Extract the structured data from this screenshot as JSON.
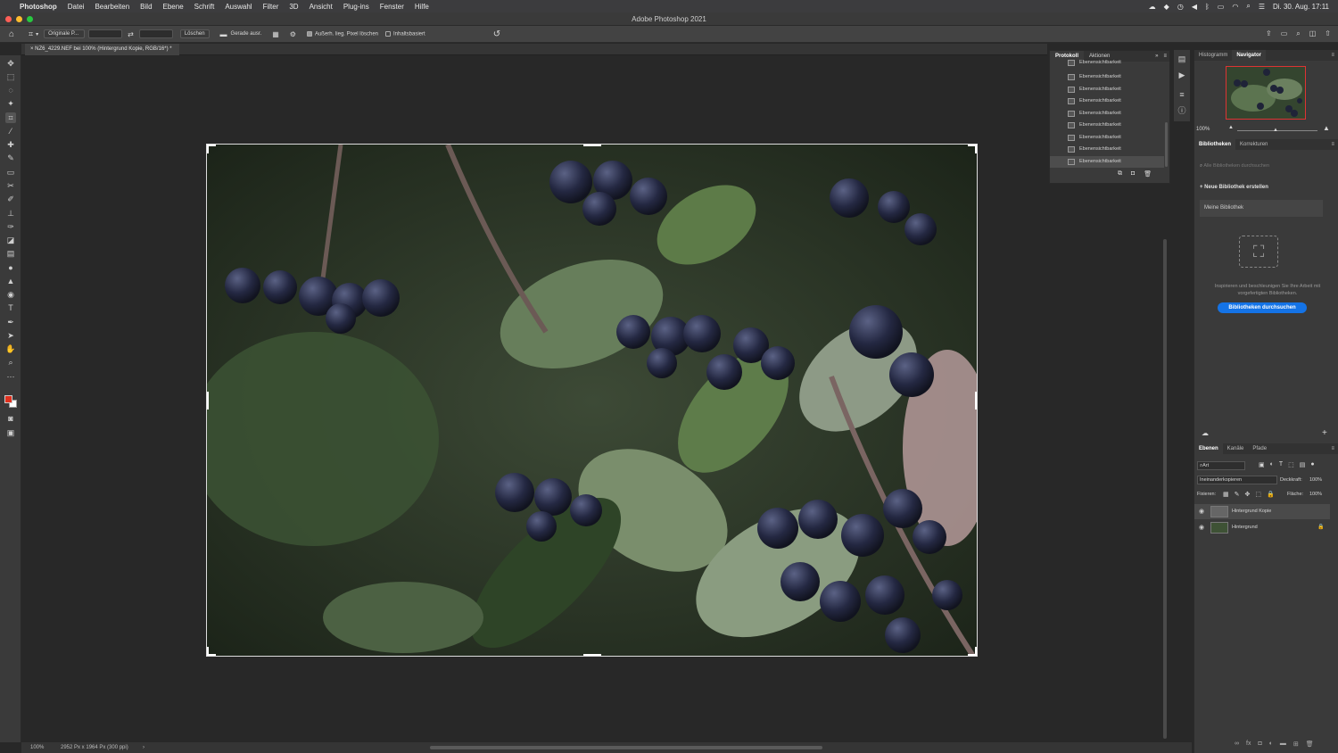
{
  "menubar": {
    "app_name": "Photoshop",
    "items": [
      "Datei",
      "Bearbeiten",
      "Bild",
      "Ebene",
      "Schrift",
      "Auswahl",
      "Filter",
      "3D",
      "Ansicht",
      "Plug-ins",
      "Fenster",
      "Hilfe"
    ],
    "datetime": "Di. 30. Aug.  17:11"
  },
  "window": {
    "title": "Adobe Photoshop 2021"
  },
  "options": {
    "ratio_select": "Originale P...",
    "clear_label": "Löschen",
    "straighten_label": "Gerade ausr.",
    "delete_cropped_label": "Außerh. lieg. Pixel löschen",
    "content_aware_label": "Inhaltsbasiert"
  },
  "document": {
    "tab_title": "NZ6_4229.NEF bei 100% (Hintergrund Kopie, RGB/16*) *",
    "zoom": "100%",
    "info": "2952 Px x 1964 Px (300 ppi)"
  },
  "protocol": {
    "tabs": [
      "Protokoll",
      "Aktionen"
    ],
    "items": [
      "Ebenensichtbarkeit",
      "Ebenensichtbarkeit",
      "Ebenensichtbarkeit",
      "Ebenensichtbarkeit",
      "Ebenensichtbarkeit",
      "Ebenensichtbarkeit",
      "Ebenensichtbarkeit",
      "Ebenensichtbarkeit",
      "Ebenensichtbarkeit"
    ]
  },
  "navigator": {
    "tabs": [
      "Histogramm",
      "Navigator"
    ],
    "zoom": "100%"
  },
  "libraries": {
    "tabs": [
      "Bibliotheken",
      "Korrekturen"
    ],
    "search_placeholder": "Alle Bibliotheken durchsuchen",
    "new_library": "Neue Bibliothek erstellen",
    "my_library": "Meine Bibliothek",
    "promo_text": "Inspirieren und beschleunigen Sie Ihre Arbeit mit vorgefertigten Bibliotheken.",
    "browse_button": "Bibliotheken durchsuchen"
  },
  "layers": {
    "tabs": [
      "Ebenen",
      "Kanäle",
      "Pfade"
    ],
    "filter_kind": "Art",
    "blend_mode": "Ineinanderkopieren",
    "opacity_label": "Deckkraft:",
    "opacity_value": "100%",
    "lock_label": "Fixieren:",
    "fill_label": "Fläche:",
    "fill_value": "100%",
    "items": [
      {
        "name": "Hintergrund Kopie"
      },
      {
        "name": "Hintergrund"
      }
    ]
  },
  "colors": {
    "foreground": "#e0301e",
    "background": "#ffffff",
    "accent_button": "#1473e6"
  }
}
